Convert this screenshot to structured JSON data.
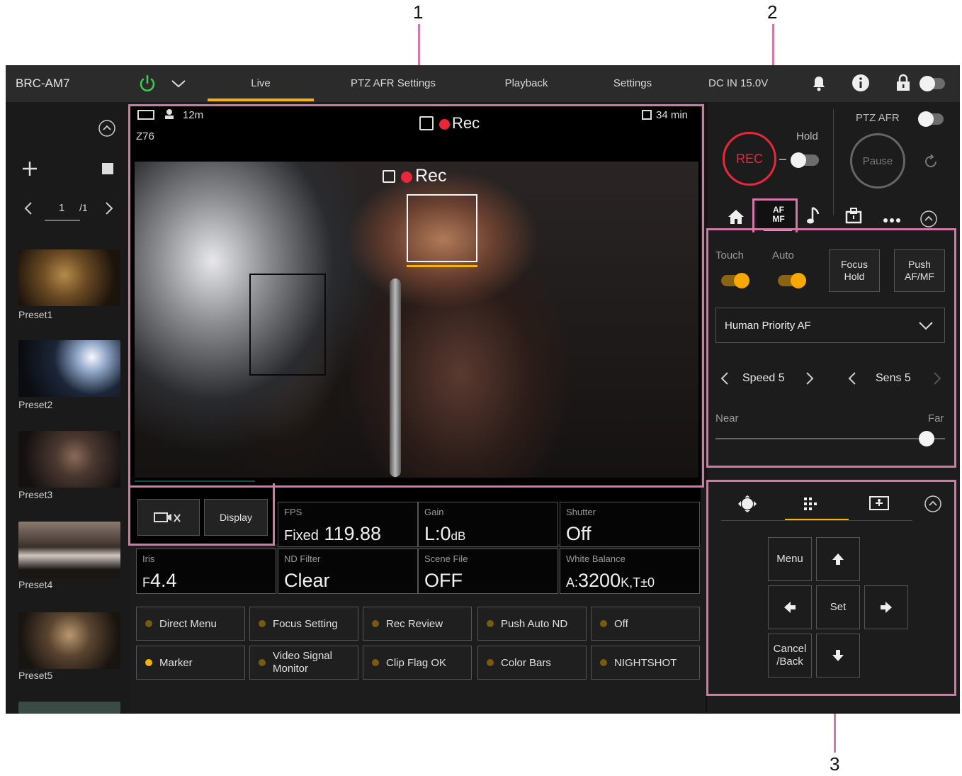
{
  "callouts": [
    "1",
    "2",
    "3"
  ],
  "topbar": {
    "model": "BRC-AM7",
    "tabs": [
      "Live",
      "PTZ AFR Settings",
      "Playback",
      "Settings"
    ],
    "active_tab": "Live",
    "power": "DC IN 15.0V"
  },
  "presets": {
    "page_current": "1",
    "page_total": "/1",
    "items": [
      "Preset1",
      "Preset2",
      "Preset3",
      "Preset4",
      "Preset5"
    ]
  },
  "viewer": {
    "clip_length": "12m",
    "lens_value": "Z76",
    "remaining": "34 min",
    "rec_label": "Rec",
    "display_button": "Display"
  },
  "info": {
    "fps": {
      "label": "FPS",
      "prefix": "Fixed",
      "value": "119.88"
    },
    "gain": {
      "label": "Gain",
      "value": "L:0",
      "unit": "dB"
    },
    "shutter": {
      "label": "Shutter",
      "value": "Off"
    },
    "iris": {
      "label": "Iris",
      "prefix": "F",
      "value": "4.4"
    },
    "nd": {
      "label": "ND Filter",
      "value": "Clear"
    },
    "scene": {
      "label": "Scene File",
      "value": "OFF"
    },
    "wb": {
      "label": "White Balance",
      "prefix": "A:",
      "value": "3200",
      "suffix": "K,T±0"
    }
  },
  "assign_buttons": [
    {
      "label": "Direct Menu",
      "on": false
    },
    {
      "label": "Focus Setting",
      "on": false
    },
    {
      "label": "Rec Review",
      "on": false
    },
    {
      "label": "Push Auto ND",
      "on": false
    },
    {
      "label": "Off",
      "on": false
    },
    {
      "label": "Marker",
      "on": true
    },
    {
      "label": "Video Signal Monitor",
      "on": false
    },
    {
      "label": "Clip Flag OK",
      "on": false
    },
    {
      "label": "Color Bars",
      "on": false
    },
    {
      "label": "NIGHTSHOT",
      "on": false
    }
  ],
  "rec": {
    "rec_button": "REC",
    "hold_label": "Hold",
    "ptz_afr_label": "PTZ AFR",
    "pause_button": "Pause"
  },
  "focus": {
    "tab_af_mf": "AF MF",
    "touch_label": "Touch",
    "auto_label": "Auto",
    "focus_hold": "Focus Hold",
    "push_af_mf": "Push AF/MF",
    "mode_select": "Human Priority AF",
    "speed": "Speed 5",
    "sens": "Sens 5",
    "near": "Near",
    "far": "Far",
    "focus_position": 0.92
  },
  "menu_panel": {
    "menu": "Menu",
    "set": "Set",
    "cancel": "Cancel /Back"
  },
  "colors": {
    "accent": "#f5b400",
    "rec_red": "#e8273a",
    "callout_pink": "#d277a6",
    "power_green": "#3ccf4e"
  }
}
